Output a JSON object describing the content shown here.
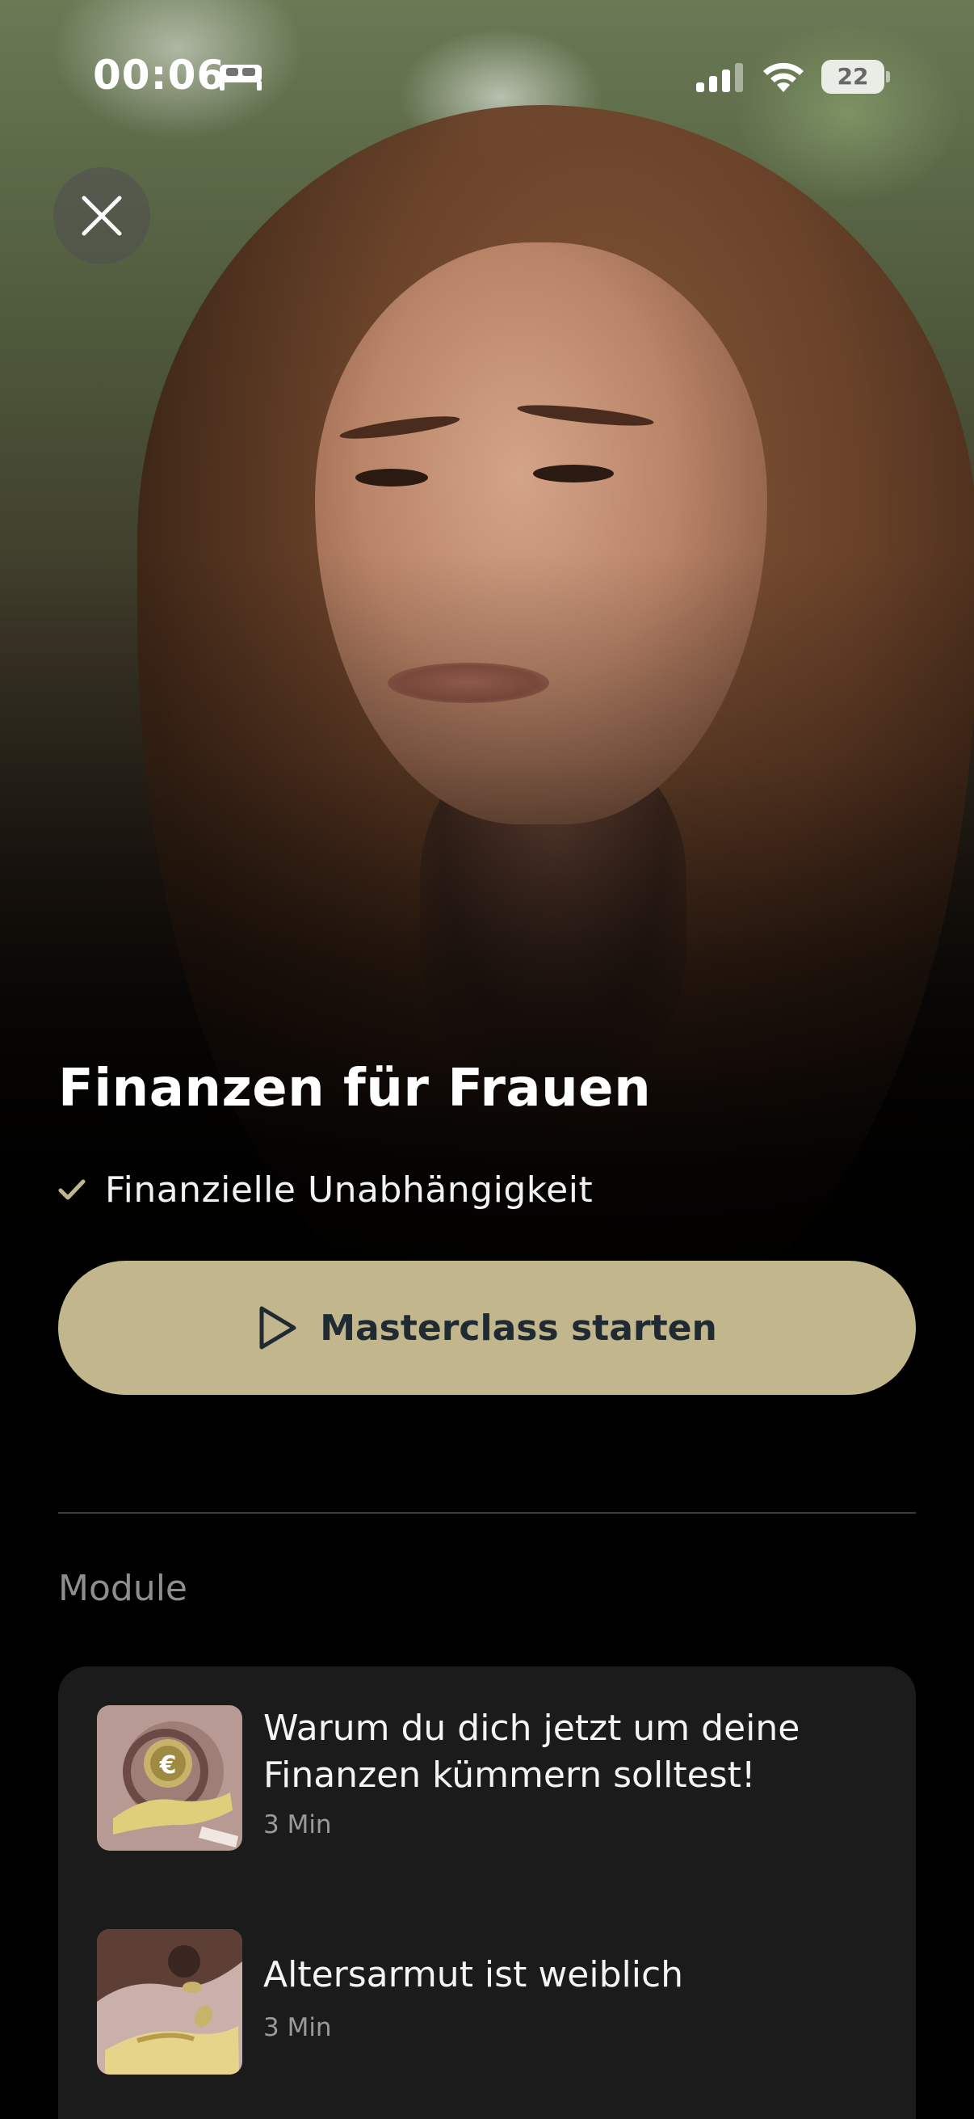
{
  "status_bar": {
    "time": "00:06",
    "battery": "22",
    "icons": [
      "bed-icon",
      "signal-icon",
      "wifi-icon",
      "battery-icon"
    ]
  },
  "header": {
    "close_icon": "close-icon"
  },
  "course": {
    "title": "Finanzen für Frauen",
    "benefits": [
      "Finanzielle Unabhängigkeit"
    ]
  },
  "cta": {
    "label": "Masterclass starten",
    "icon": "play-icon"
  },
  "modules_section": {
    "label": "Module",
    "items": [
      {
        "title": "Warum du dich jetzt um deine Finanzen kümmern solltest!",
        "duration": "3 Min"
      },
      {
        "title": "Altersarmut ist weiblich",
        "duration": "3 Min"
      }
    ]
  },
  "colors": {
    "accent": "#c2b68c",
    "check": "#c2b68c",
    "card_bg": "#1b1b1b",
    "background": "#000000",
    "cta_text": "#1f2a33"
  }
}
